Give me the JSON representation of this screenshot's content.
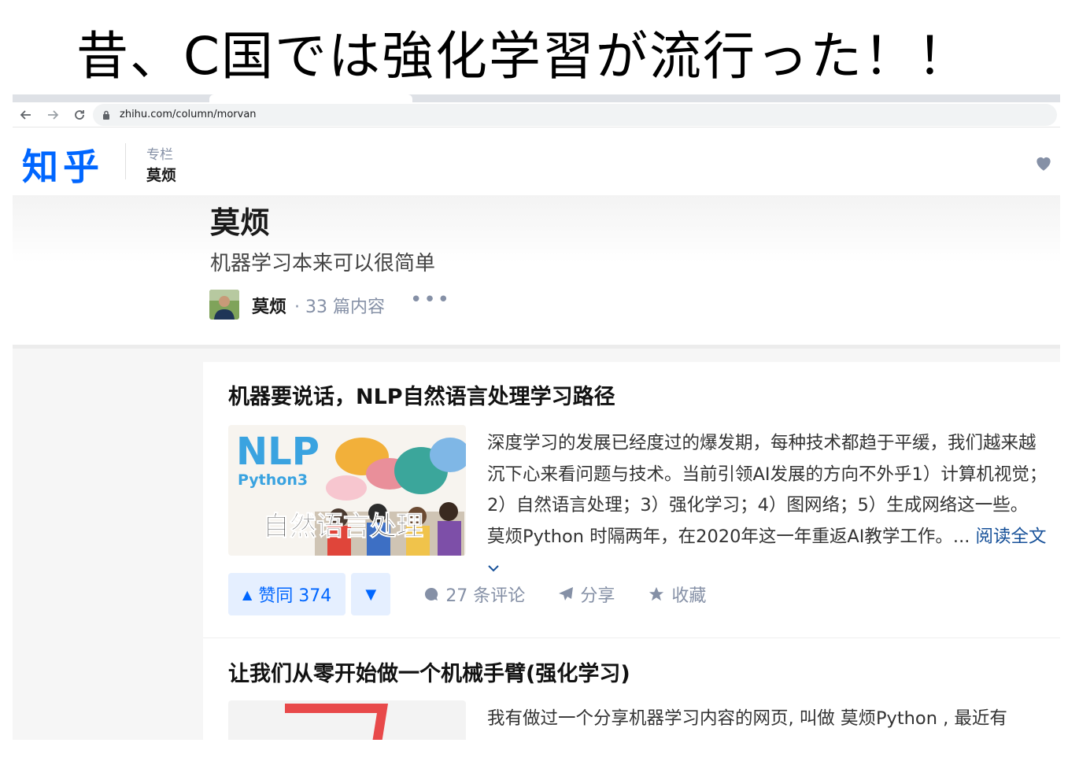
{
  "slide": {
    "caption": "昔、C国では強化学習が流行った！！"
  },
  "browser": {
    "url": "zhihu.com/column/morvan"
  },
  "zhihu_header": {
    "logo": "知乎",
    "section_label": "专栏",
    "column_name": "莫烦"
  },
  "column": {
    "title": "莫烦",
    "description": "机器学习本来可以很简单",
    "author": "莫烦",
    "post_count": "· 33 篇内容",
    "more_label": "•••"
  },
  "articles": [
    {
      "title": "机器要说话，NLP自然语言处理学习路径",
      "thumbnail": {
        "headline": "NLP",
        "sub": "Python3",
        "caption": "自然语言处理"
      },
      "excerpt": "深度学习的发展已经度过的爆发期，每种技术都趋于平缓，我们越来越沉下心来看问题与技术。当前引领AI发展的方向不外乎1）计算机视觉；2）自然语言处理；3）强化学习；4）图网络；5）生成网络这一些。 莫烦Python 时隔两年，在2020年这一年重返AI教学工作。...",
      "read_more": "阅读全文",
      "upvote": "赞同 374",
      "comments": "27 条评论",
      "share": "分享",
      "favorite": "收藏"
    },
    {
      "title": "让我们从零开始做一个机械手臂(强化学习)",
      "excerpt": "我有做过一个分享机器学习内容的网页, 叫做 莫烦Python , 最近有"
    }
  ],
  "colors": {
    "zhihu_blue": "#0066ff",
    "muted": "#8590a6",
    "link": "#175199"
  }
}
